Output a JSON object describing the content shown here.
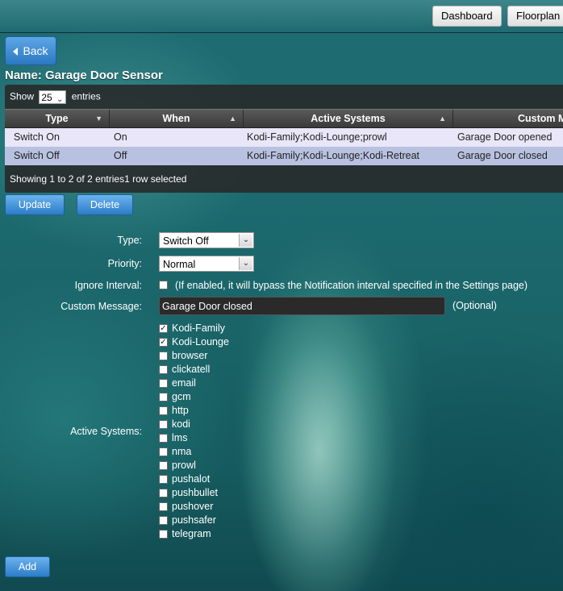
{
  "nav": {
    "dashboard": "Dashboard",
    "floorplan": "Floorplan"
  },
  "back_label": "Back",
  "name_title": "Name: Garage Door Sensor",
  "table": {
    "show_prefix": "Show",
    "show_value": "25",
    "show_suffix": "entries",
    "columns": [
      "Type",
      "When",
      "Active Systems",
      "Custom Message"
    ],
    "rows": [
      {
        "type": "Switch On",
        "when": "On",
        "systems": "Kodi-Family;Kodi-Lounge;prowl",
        "message": "Garage Door opened"
      },
      {
        "type": "Switch Off",
        "when": "Off",
        "systems": "Kodi-Family;Kodi-Lounge;Kodi-Retreat",
        "message": "Garage Door closed"
      }
    ],
    "info": "Showing 1 to 2 of 2 entries1 row selected"
  },
  "buttons": {
    "update": "Update",
    "delete": "Delete",
    "add": "Add"
  },
  "form": {
    "type_label": "Type:",
    "type_value": "Switch Off",
    "priority_label": "Priority:",
    "priority_value": "Normal",
    "ignore_label": "Ignore Interval:",
    "ignore_checked": false,
    "ignore_hint": "(If enabled, it will bypass the Notification interval specified in the Settings page)",
    "message_label": "Custom Message:",
    "message_value": "Garage Door closed",
    "message_hint": "(Optional)",
    "systems_label": "Active Systems:",
    "systems": [
      {
        "name": "Kodi-Family",
        "checked": true
      },
      {
        "name": "Kodi-Lounge",
        "checked": true
      },
      {
        "name": "browser",
        "checked": false
      },
      {
        "name": "clickatell",
        "checked": false
      },
      {
        "name": "email",
        "checked": false
      },
      {
        "name": "gcm",
        "checked": false
      },
      {
        "name": "http",
        "checked": false
      },
      {
        "name": "kodi",
        "checked": false
      },
      {
        "name": "lms",
        "checked": false
      },
      {
        "name": "nma",
        "checked": false
      },
      {
        "name": "prowl",
        "checked": false
      },
      {
        "name": "pushalot",
        "checked": false
      },
      {
        "name": "pushbullet",
        "checked": false
      },
      {
        "name": "pushover",
        "checked": false
      },
      {
        "name": "pushsafer",
        "checked": false
      },
      {
        "name": "telegram",
        "checked": false
      }
    ]
  },
  "colors": {
    "accent_blue": "#2b7cc8",
    "row_selected": "#b8c2e0",
    "row_normal": "#e8e6f8"
  }
}
